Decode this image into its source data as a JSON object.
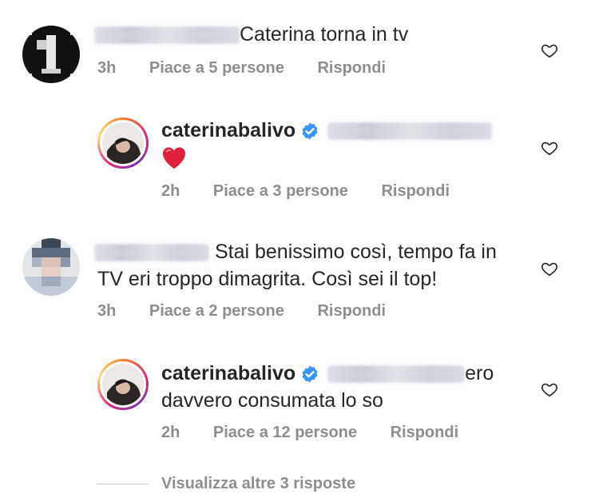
{
  "comments": [
    {
      "text": "Caterina torna in tv",
      "time": "3h",
      "likes": "Piace a 5 persone",
      "reply": "Rispondi"
    },
    {
      "username": "caterinabalivo",
      "text": "❤️",
      "time": "2h",
      "likes": "Piace a 3 persone",
      "reply": "Rispondi"
    },
    {
      "text_line1": "Stai benissimo così, tempo fa in",
      "text_line2": "TV eri troppo dimagrita. Così sei il top!",
      "time": "3h",
      "likes": "Piace a 2 persone",
      "reply": "Rispondi"
    },
    {
      "username": "caterinabalivo",
      "text_line1": "ero",
      "text_line2": "davvero consumata lo so",
      "time": "2h",
      "likes": "Piace a 12 persone",
      "reply": "Rispondi"
    }
  ],
  "view_more": "Visualizza altre 3 risposte",
  "colors": {
    "muted": "#8e8e8e",
    "verified": "#3897f0",
    "heart": "#ed4956"
  },
  "icons": [
    "heart-outline-icon",
    "verified-badge-icon",
    "red-heart-emoji"
  ]
}
